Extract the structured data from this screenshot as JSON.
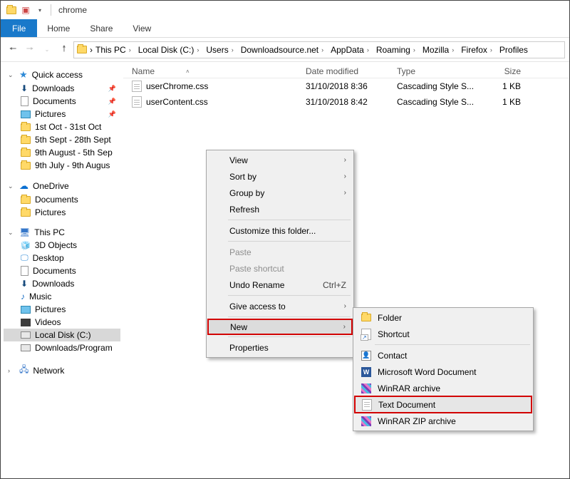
{
  "window": {
    "title": "chrome"
  },
  "ribbon": {
    "file": "File",
    "tabs": [
      "Home",
      "Share",
      "View"
    ]
  },
  "breadcrumb": [
    "This PC",
    "Local Disk (C:)",
    "Users",
    "Downloadsource.net",
    "AppData",
    "Roaming",
    "Mozilla",
    "Firefox",
    "Profiles"
  ],
  "sidebar": {
    "quick": {
      "label": "Quick access",
      "items": [
        {
          "label": "Downloads",
          "pin": true,
          "icon": "down"
        },
        {
          "label": "Documents",
          "pin": true,
          "icon": "doc"
        },
        {
          "label": "Pictures",
          "pin": true,
          "icon": "img"
        },
        {
          "label": "1st Oct - 31st Oct",
          "icon": "folder"
        },
        {
          "label": "5th Sept - 28th Sept",
          "icon": "folder"
        },
        {
          "label": "9th August - 5th Sep",
          "icon": "folder"
        },
        {
          "label": "9th July - 9th Augus",
          "icon": "folder"
        }
      ]
    },
    "onedrive": {
      "label": "OneDrive",
      "items": [
        {
          "label": "Documents",
          "icon": "folder"
        },
        {
          "label": "Pictures",
          "icon": "folder"
        }
      ]
    },
    "thispc": {
      "label": "This PC",
      "items": [
        {
          "label": "3D Objects",
          "icon": "obj"
        },
        {
          "label": "Desktop",
          "icon": "desk"
        },
        {
          "label": "Documents",
          "icon": "doc"
        },
        {
          "label": "Downloads",
          "icon": "down"
        },
        {
          "label": "Music",
          "icon": "mus"
        },
        {
          "label": "Pictures",
          "icon": "img"
        },
        {
          "label": "Videos",
          "icon": "vid"
        },
        {
          "label": "Local Disk (C:)",
          "icon": "drive",
          "selected": true
        },
        {
          "label": "Downloads/Program",
          "icon": "drive"
        }
      ]
    },
    "network": {
      "label": "Network"
    }
  },
  "columns": {
    "name": "Name",
    "date": "Date modified",
    "type": "Type",
    "size": "Size"
  },
  "files": [
    {
      "name": "userChrome.css",
      "date": "31/10/2018 8:36",
      "type": "Cascading Style S...",
      "size": "1 KB"
    },
    {
      "name": "userContent.css",
      "date": "31/10/2018 8:42",
      "type": "Cascading Style S...",
      "size": "1 KB"
    }
  ],
  "context": {
    "items": [
      {
        "label": "View",
        "arrow": true
      },
      {
        "label": "Sort by",
        "arrow": true
      },
      {
        "label": "Group by",
        "arrow": true
      },
      {
        "label": "Refresh"
      },
      {
        "sep": true
      },
      {
        "label": "Customize this folder..."
      },
      {
        "sep": true
      },
      {
        "label": "Paste",
        "disabled": true
      },
      {
        "label": "Paste shortcut",
        "disabled": true
      },
      {
        "label": "Undo Rename",
        "shortcut": "Ctrl+Z"
      },
      {
        "sep": true
      },
      {
        "label": "Give access to",
        "arrow": true
      },
      {
        "sep": true
      },
      {
        "label": "New",
        "arrow": true,
        "highlight": true
      },
      {
        "sep": true
      },
      {
        "label": "Properties"
      }
    ]
  },
  "submenu": {
    "items": [
      {
        "label": "Folder",
        "icon": "folder"
      },
      {
        "label": "Shortcut",
        "icon": "shortcut"
      },
      {
        "sep": true
      },
      {
        "label": "Contact",
        "icon": "contact"
      },
      {
        "label": "Microsoft Word Document",
        "icon": "word"
      },
      {
        "label": "WinRAR archive",
        "icon": "winrar"
      },
      {
        "label": "Text Document",
        "icon": "txt",
        "selected": true
      },
      {
        "label": "WinRAR ZIP archive",
        "icon": "winrar"
      }
    ]
  }
}
